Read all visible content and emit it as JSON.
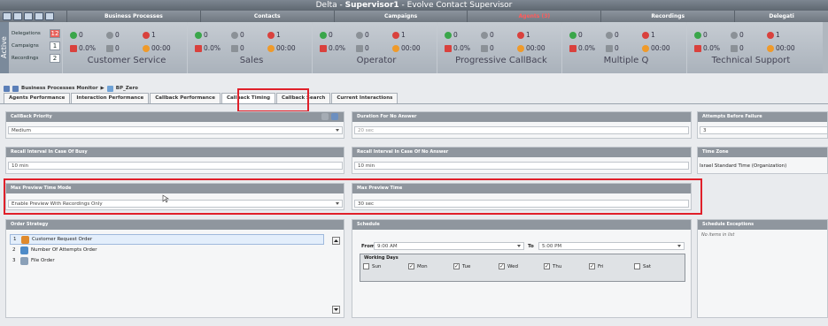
{
  "window": {
    "title_prefix": "Delta - ",
    "title_user": "Supervisor1",
    "title_suffix": " - Evolve Contact Supervisor"
  },
  "nav": {
    "tabs": [
      "Business Processes",
      "Contacts",
      "Campaigns",
      "Agents (3)",
      "Recordings",
      "Delegati"
    ],
    "active_index": 3
  },
  "side_counts": {
    "active_label": "Active",
    "delegations": {
      "label": "Delegations",
      "value": "12"
    },
    "campaigns": {
      "label": "Campaigns",
      "value": "1"
    },
    "recordings": {
      "label": "Recordings",
      "value": "2"
    }
  },
  "groups": [
    {
      "name": "Customer Service",
      "a": "0",
      "b": "0",
      "c": "1",
      "pct": "0.0%",
      "d": "0",
      "time": "00:00"
    },
    {
      "name": "Sales",
      "a": "0",
      "b": "0",
      "c": "1",
      "pct": "0.0%",
      "d": "0",
      "time": "00:00"
    },
    {
      "name": "Operator",
      "a": "0",
      "b": "0",
      "c": "1",
      "pct": "0.0%",
      "d": "0",
      "time": "00:00"
    },
    {
      "name": "Progressive CallBack",
      "a": "0",
      "b": "0",
      "c": "1",
      "pct": "0.0%",
      "d": "0",
      "time": "00:00"
    },
    {
      "name": "Multiple Q",
      "a": "0",
      "b": "0",
      "c": "1",
      "pct": "0.0%",
      "d": "0",
      "time": "00:00"
    },
    {
      "name": "Technical Support",
      "a": "0",
      "b": "0",
      "c": "1",
      "pct": "0.0%",
      "d": "0",
      "time": "00:00"
    }
  ],
  "breadcrumb": {
    "root": "Business Processes Monitor",
    "sep": "▶",
    "item": "BP_Zero"
  },
  "tabs": [
    "Agents Performance",
    "Interaction Performance",
    "Callback Performance",
    "Callback Timing",
    "Callback Search",
    "Current Interactions"
  ],
  "selected_tab": 3,
  "panels": {
    "callback_priority": {
      "header": "CallBack Priority",
      "value": "Medium"
    },
    "duration_no_answer": {
      "header": "Duration For No Answer",
      "value": "20  sec"
    },
    "attempts_before_failure": {
      "header": "Attempts Before Failure",
      "value": "3"
    },
    "recall_busy": {
      "header": "Recall Interval In Case Of Busy",
      "value": "10  min"
    },
    "recall_no_answer": {
      "header": "Recall Interval In Case Of No Answer",
      "value": "10  min"
    },
    "time_zone": {
      "header": "Time Zone",
      "value": "Israel Standard Time (Organization)"
    },
    "max_preview_mode": {
      "header": "Max Preview Time Mode",
      "value": "Enable Preview With Recordings Only"
    },
    "max_preview_time": {
      "header": "Max Preview Time",
      "value": "30  sec"
    },
    "order_strategy": {
      "header": "Order Strategy",
      "items": [
        {
          "num": "1",
          "label": "Customer Request Order"
        },
        {
          "num": "2",
          "label": "Number Of Attempts Order"
        },
        {
          "num": "3",
          "label": "File Order"
        }
      ]
    },
    "schedule": {
      "header": "Schedule",
      "from_label": "From",
      "from_value": "9:00 AM",
      "to_label": "To",
      "to_value": "5:00 PM",
      "working_days_label": "Working Days",
      "days": [
        {
          "name": "Sun",
          "checked": false
        },
        {
          "name": "Mon",
          "checked": true
        },
        {
          "name": "Tue",
          "checked": true
        },
        {
          "name": "Wed",
          "checked": true
        },
        {
          "name": "Thu",
          "checked": true
        },
        {
          "name": "Fri",
          "checked": true
        },
        {
          "name": "Sat",
          "checked": false
        }
      ]
    },
    "schedule_exceptions": {
      "header": "Schedule Exceptions",
      "empty_text": "No items in list"
    }
  },
  "colors": {
    "highlight": "#e0202a",
    "panel_header": "#8f969e",
    "hot_count": "#e8605a"
  }
}
